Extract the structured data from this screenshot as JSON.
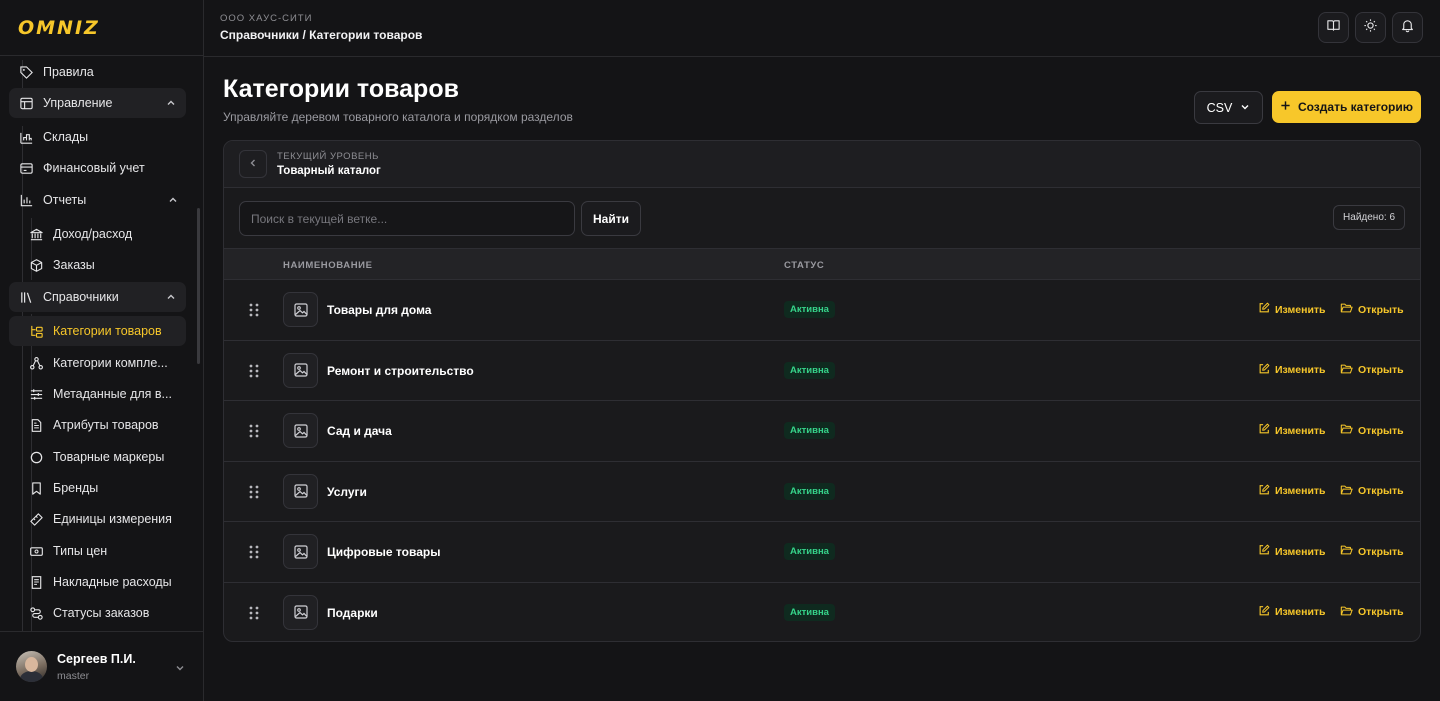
{
  "brand": {
    "logo_text": "OMNIZ",
    "accent": "#f7c72a",
    "status_green": "#36d38a"
  },
  "header": {
    "company": "ООО ХАУС-СИТИ",
    "breadcrumb": "Справочники / Категории товаров",
    "icons": [
      "book-icon",
      "sun-icon",
      "bell-icon"
    ]
  },
  "sidebar": {
    "items": [
      {
        "label": "Правила",
        "icon": "tag-icon"
      },
      {
        "label": "Управление",
        "icon": "layout-icon",
        "expanded": true
      },
      {
        "label": "Склады",
        "icon": "warehouse-icon"
      },
      {
        "label": "Финансовый учет",
        "icon": "wallet-icon"
      },
      {
        "label": "Отчеты",
        "icon": "chart-icon",
        "expanded": true
      },
      {
        "label": "Доход/расход",
        "icon": "bank-icon"
      },
      {
        "label": "Заказы",
        "icon": "box-icon"
      },
      {
        "label": "Справочники",
        "icon": "library-icon",
        "expanded": true
      },
      {
        "label": "Категории товаров",
        "icon": "folder-tree-icon",
        "active": true
      },
      {
        "label": "Категории компле...",
        "icon": "network-icon"
      },
      {
        "label": "Метаданные для в...",
        "icon": "sliders-icon"
      },
      {
        "label": "Атрибуты товаров",
        "icon": "document-icon"
      },
      {
        "label": "Товарные маркеры",
        "icon": "circle-icon"
      },
      {
        "label": "Бренды",
        "icon": "bookmark-icon"
      },
      {
        "label": "Единицы измерения",
        "icon": "ruler-icon"
      },
      {
        "label": "Типы цен",
        "icon": "banknote-icon"
      },
      {
        "label": "Накладные расходы",
        "icon": "receipt-icon"
      },
      {
        "label": "Статусы заказов",
        "icon": "route-icon"
      }
    ]
  },
  "user": {
    "name": "Сергеев П.И.",
    "role": "master"
  },
  "page": {
    "title": "Категории товаров",
    "subtitle": "Управляйте деревом товарного каталога и порядком разделов",
    "csv_label": "CSV",
    "create_label": "Создать категорию"
  },
  "level": {
    "label": "ТЕКУЩИЙ УРОВЕНЬ",
    "value": "Товарный каталог"
  },
  "search": {
    "placeholder": "Поиск в текущей ветке...",
    "value": "",
    "button": "Найти",
    "found": "Найдено: 6"
  },
  "table": {
    "columns": [
      "НАИМЕНОВАНИЕ",
      "СТАТУС"
    ],
    "edit_label": "Изменить",
    "open_label": "Открыть",
    "rows": [
      {
        "name": "Товары для дома",
        "status": "Активна"
      },
      {
        "name": "Ремонт и строительство",
        "status": "Активна"
      },
      {
        "name": "Сад и дача",
        "status": "Активна"
      },
      {
        "name": "Услуги",
        "status": "Активна"
      },
      {
        "name": "Цифровые товары",
        "status": "Активна"
      },
      {
        "name": "Подарки",
        "status": "Активна"
      }
    ]
  }
}
